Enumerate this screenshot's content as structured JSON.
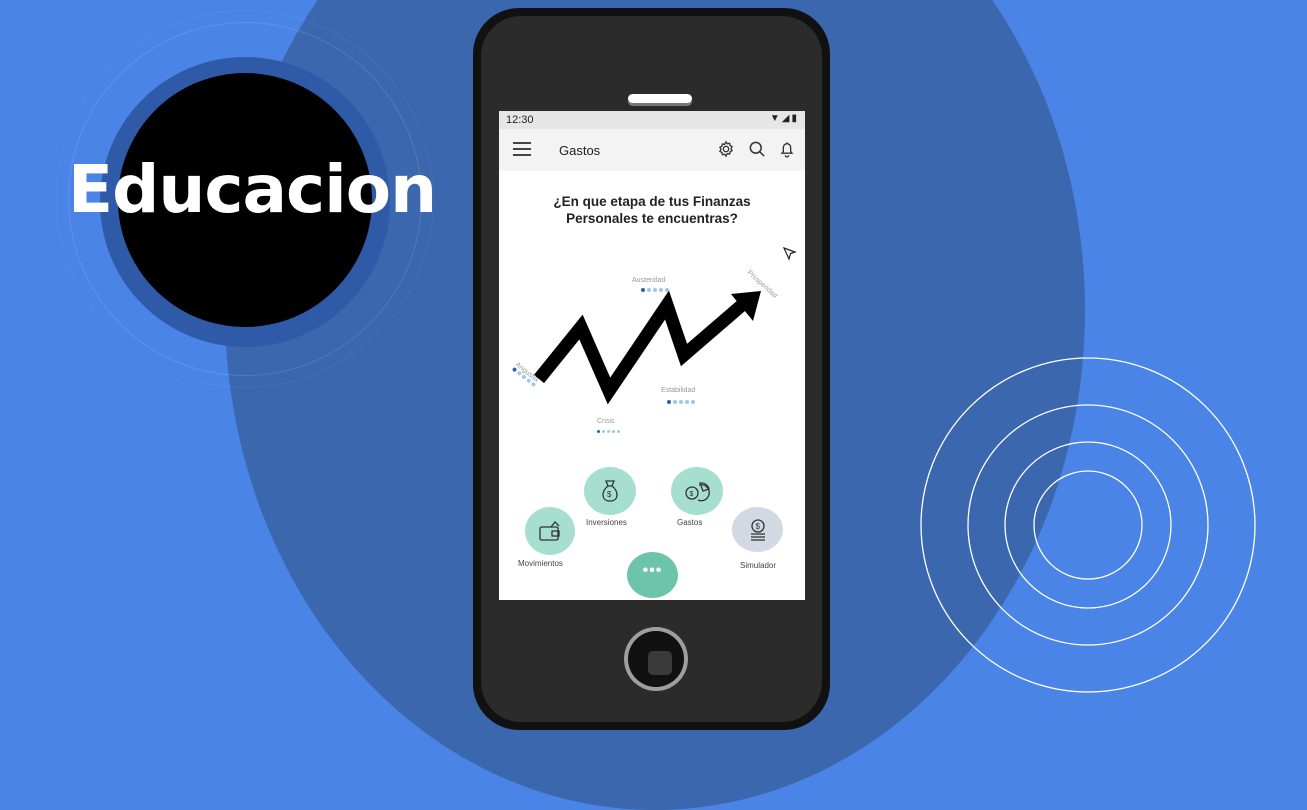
{
  "slide": {
    "title": "Educacion",
    "colors": {
      "background": "#4a84e6",
      "circle": "#3b67ae",
      "accent": "#a6ded0",
      "fab": "#6cc5a9"
    }
  },
  "status_bar": {
    "time": "12:30",
    "icons": [
      "wifi-icon",
      "signal-icon",
      "battery-icon"
    ]
  },
  "app_bar": {
    "menu_icon": "hamburger-menu-icon",
    "title": "Gastos",
    "actions": [
      "gear-icon",
      "search-icon",
      "bell-icon"
    ]
  },
  "main": {
    "question": "¿En que etapa de tus Finanzas Personales te encuentras?",
    "stages": [
      {
        "label": "Angustia"
      },
      {
        "label": "Crisis"
      },
      {
        "label": "Austeridad"
      },
      {
        "label": "Estabilidad"
      },
      {
        "label": "Prosperidad"
      }
    ]
  },
  "menu": {
    "items": [
      {
        "label": "Movimientos",
        "icon": "wallet-icon"
      },
      {
        "label": "Inversiones",
        "icon": "money-bag-icon"
      },
      {
        "label": "Gastos",
        "icon": "pie-chart-money-icon"
      },
      {
        "label": "Simulador",
        "icon": "coin-stack-icon"
      }
    ],
    "fab_label": "•••"
  }
}
